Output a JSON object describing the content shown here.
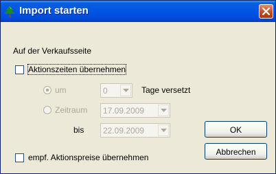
{
  "window": {
    "title": "Import starten"
  },
  "section_label": "Auf der Verkaufsseite",
  "options": {
    "aktionszeiten": {
      "label": "Aktionszeiten übernehmen",
      "checked": false
    },
    "um": {
      "label": "um",
      "selected": true,
      "enabled": false,
      "value": "0",
      "suffix": "Tage versetzt"
    },
    "zeitraum": {
      "label": "Zeitraum",
      "selected": false,
      "enabled": false,
      "from": "17.09.2009",
      "to_label": "bis",
      "to": "22.09.2009"
    },
    "preise": {
      "label": "empf. Aktionspreise übernehmen",
      "checked": false
    }
  },
  "buttons": {
    "ok": "OK",
    "cancel": "Abbrechen"
  },
  "icons": {
    "app": "tree-icon",
    "close": "close-icon",
    "dropdown": "chevron-down-icon"
  },
  "colors": {
    "titlebar": "#0055e5",
    "close_button": "#c9451e",
    "dialog_background": "#ece9d8",
    "disabled_text": "#aca899"
  }
}
